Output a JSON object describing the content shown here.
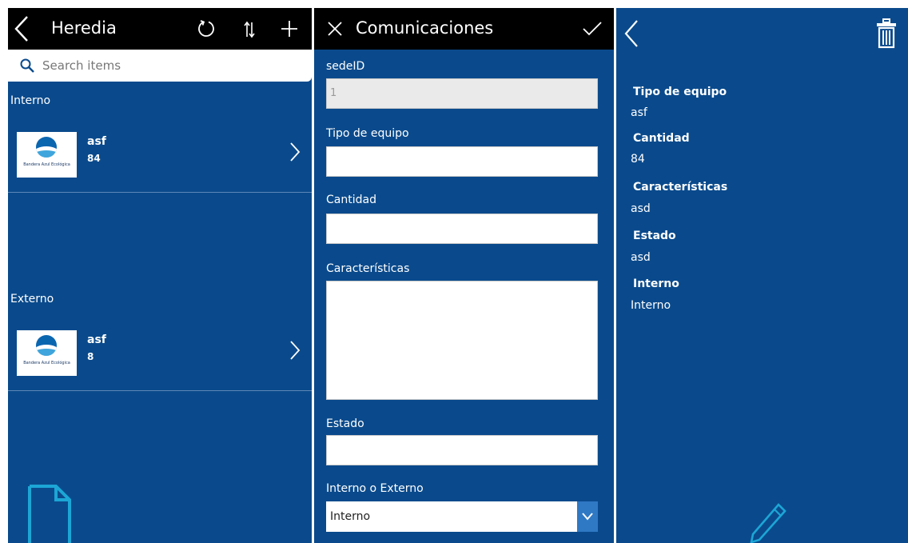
{
  "list_panel": {
    "header": {
      "title": "Heredia",
      "back_icon": "chevron-left-icon",
      "refresh_icon": "refresh-icon",
      "sort_icon": "sort-icon",
      "add_icon": "plus-icon"
    },
    "search": {
      "placeholder": "Search items",
      "icon": "search-icon"
    },
    "groups": [
      {
        "label": "Interno",
        "items": [
          {
            "title": "asf",
            "subtitle": "84",
            "logo_text": "Bandera Azul Ecológica"
          }
        ]
      },
      {
        "label": "Externo",
        "items": [
          {
            "title": "asf",
            "subtitle": "8",
            "logo_text": "Bandera Azul Ecológica"
          }
        ]
      }
    ],
    "footer_icon": "document-icon"
  },
  "form_panel": {
    "header": {
      "title": "Comunicaciones",
      "cancel_icon": "close-icon",
      "submit_icon": "checkmark-icon"
    },
    "fields": {
      "sede_id": {
        "label": "sedeID",
        "value": "1"
      },
      "tipo_equipo": {
        "label": "Tipo de equipo",
        "value": ""
      },
      "cantidad": {
        "label": "Cantidad",
        "value": ""
      },
      "caracteristicas": {
        "label": "Características",
        "value": ""
      },
      "estado": {
        "label": "Estado",
        "value": ""
      },
      "interno_externo": {
        "label": "Interno o Externo",
        "value": "Interno"
      }
    }
  },
  "detail_panel": {
    "header": {
      "back_icon": "chevron-left-icon",
      "delete_icon": "trash-icon"
    },
    "fields": [
      {
        "label": "Tipo de equipo",
        "value": "asf"
      },
      {
        "label": "Cantidad",
        "value": "84"
      },
      {
        "label": "Características",
        "value": "asd"
      },
      {
        "label": "Estado",
        "value": "asd"
      },
      {
        "label": "Interno",
        "value": "Interno"
      }
    ],
    "edit_icon": "pencil-icon"
  },
  "colors": {
    "panel_bg": "#0a4a8c",
    "header_bg": "#000000",
    "accent": "#2f78c4",
    "icon_cyan": "#1ca6d6"
  }
}
